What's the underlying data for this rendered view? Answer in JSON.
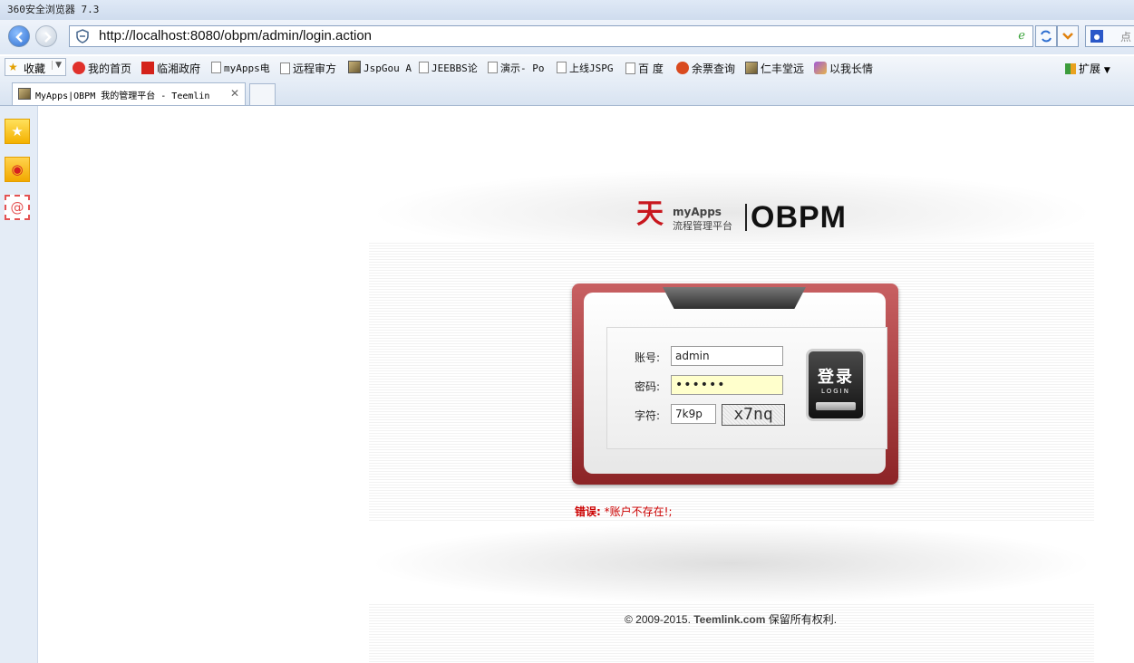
{
  "browser": {
    "title": "360安全浏览器 7.3",
    "url": "http://localhost:8080/obpm/admin/login.action",
    "search_label": "点"
  },
  "favorites": {
    "collect_label": "收藏",
    "items": [
      "我的首页",
      "临湘政府",
      "myApps电",
      "远程审方",
      "JspGou A",
      "JEEBBS论",
      "演示- Po",
      "上线JSPG",
      "百 度",
      "余票查询",
      "仁丰堂远",
      "以我长情"
    ],
    "extensions_label": "扩展"
  },
  "tab": {
    "title": "MyApps|OBPM 我的管理平台 - Teemlin"
  },
  "page": {
    "logo": {
      "seal": "天",
      "brand_en": "myApps",
      "brand_cn": "流程管理平台",
      "product": "OBPM"
    },
    "form": {
      "username_label": "账号:",
      "username_value": "admin",
      "password_label": "密码:",
      "password_value": "••••••",
      "code_label": "字符:",
      "code_value": "7k9p",
      "captcha_text": "x7nq"
    },
    "login_button": {
      "label_cn": "登录",
      "label_en": "LOGIN"
    },
    "error": {
      "prefix": "错误:",
      "message": "*账户不存在!;"
    },
    "footer": {
      "copyright": "© 2009-2015. ",
      "company": "Teemlink.com",
      "rights": " 保留所有权利."
    }
  }
}
